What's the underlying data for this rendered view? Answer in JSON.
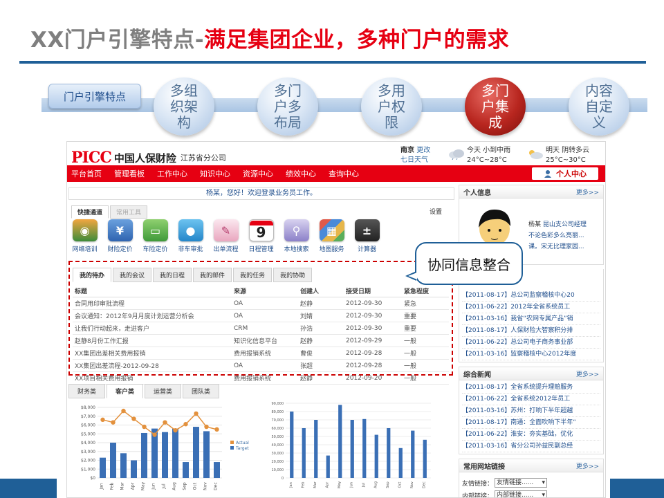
{
  "slide": {
    "title_gray": "XX门户引擎特点-",
    "title_red": "满足集团企业，多种门户的需求",
    "label": "门户引擎特点",
    "circles": [
      "多组织架构",
      "多门户多布局",
      "多用户权限",
      "多门户集成",
      "内容自定义"
    ],
    "active_index": 3,
    "callout": "协同信息整合",
    "colors": {
      "accent_blue": "#1f5f97",
      "brand_red": "#e60012"
    }
  },
  "portal": {
    "logo_mark": "PICC",
    "logo_name": "中国人保财险",
    "logo_branch": "江苏省分公司",
    "weather": {
      "city": "南京",
      "change": "更改",
      "week": "七日天气",
      "today_label": "今天 小到中雨",
      "today_temp": "24°C~28°C",
      "tomorrow_label": "明天 阴转多云",
      "tomorrow_temp": "25°C~30°C"
    },
    "nav": [
      "平台首页",
      "管理看板",
      "工作中心",
      "知识中心",
      "资源中心",
      "绩效中心",
      "查询中心"
    ],
    "personal_center": "个人中心",
    "welcome": "杨某，您好！欢迎登录业务员工作。",
    "quick_tabs": [
      "快捷通道",
      "常用工具"
    ],
    "settings": "设置",
    "apps": [
      {
        "label": "网络培训",
        "icon": "globe-icon"
      },
      {
        "label": "财险定价",
        "icon": "yen-icon"
      },
      {
        "label": "车险定价",
        "icon": "car-icon"
      },
      {
        "label": "非车审批",
        "icon": "chat-icon"
      },
      {
        "label": "出单流程",
        "icon": "pen-icon"
      },
      {
        "label": "日程管理",
        "icon": "calendar-icon",
        "day": "9"
      },
      {
        "label": "本地搜索",
        "icon": "magnifier-icon"
      },
      {
        "label": "地图服务",
        "icon": "map-icon"
      },
      {
        "label": "计算器",
        "icon": "calculator-icon"
      }
    ],
    "todo_tabs": [
      "我的待办",
      "我的会议",
      "我的日程",
      "我的邮件",
      "我的任务",
      "我的协助"
    ],
    "todo_headers": [
      "标题",
      "来源",
      "创建人",
      "接受日期",
      "紧急程度"
    ],
    "todo_rows": [
      [
        "合同用印审批流程",
        "OA",
        "赵静",
        "2012-09-30",
        "紧急"
      ],
      [
        "会议通知：2012年9月月度计划运营分析会",
        "OA",
        "刘婧",
        "2012-09-30",
        "重要"
      ],
      [
        "让我们行动起来，走进客户",
        "CRM",
        "孙浩",
        "2012-09-30",
        "重要"
      ],
      [
        "赵静8月份工作汇报",
        "知识化信息平台",
        "赵静",
        "2012-09-29",
        "一般"
      ],
      [
        "XX集团出差相关费用报销",
        "费用报销系统",
        "曹俊",
        "2012-09-28",
        "一般"
      ],
      [
        "XX集团出差流程-2012-09-28",
        "OA",
        "张超",
        "2012-09-28",
        "一般"
      ],
      [
        "XX项目相关费用报销",
        "费用报销系统",
        "赵静",
        "2012-09-20",
        "一般"
      ]
    ],
    "chart_tabs": [
      "财务类",
      "客户类",
      "运营类",
      "团队类"
    ],
    "right": {
      "personal_title": "个人信息",
      "more": "更多>>",
      "person_name": "杨某",
      "person_role": "昆山支公司经理",
      "person_line2": "不论色彩多么亮丽...",
      "person_line3": "课。宋无比理家园...",
      "news1": [
        "【2011-08-17】总公司监察稽核中心20",
        "【2011-06-22】2012年全省系统员工",
        "【2011-03-16】我省“农网专属产品”销",
        "【2011-08-17】人保财险大智察积分排",
        "【2011-06-22】总公司电子商务事业部",
        "【2011-03-16】监察稽核中心2012年度"
      ],
      "news2_title": "综合新闻",
      "news2": [
        "【2011-08-17】全省系统提升理赔服务",
        "【2011-06-22】全省系统2012年员工",
        "【2011-03-16】苏州：打响下半年超越",
        "【2011-08-17】南通：全面吹响下半年“",
        "【2011-06-22】淮安：夯实基础，优化",
        "【2011-03-16】省分公司孙益民副总经"
      ],
      "links_title": "常用网站链接",
      "friend_label": "友情链接：",
      "friend_value": "友情链接......",
      "internal_label": "内部链接：",
      "internal_value": "内部链接......"
    }
  },
  "chart_data": [
    {
      "type": "bar",
      "categories": [
        "Jan",
        "Feb",
        "Mar",
        "Apr",
        "May",
        "Jun",
        "Jul",
        "Aug",
        "Sep",
        "Oct",
        "Nov",
        "Dec"
      ],
      "series": [
        {
          "name": "Target",
          "type": "bar",
          "values": [
            2300,
            4000,
            2800,
            2000,
            5100,
            5600,
            5200,
            5600,
            1800,
            5800,
            5300,
            1800
          ]
        },
        {
          "name": "Actual",
          "type": "line",
          "values": [
            6600,
            6300,
            7600,
            6700,
            5800,
            4900,
            6300,
            5400,
            6100,
            7300,
            5800,
            5500
          ]
        }
      ],
      "ylim": [
        0,
        8000
      ],
      "yticks": [
        "$0",
        "$1,000",
        "$2,000",
        "$3,000",
        "$4,000",
        "$5,000",
        "$6,000",
        "$7,000",
        "$8,000"
      ],
      "legend": "right",
      "colors": {
        "Target": "#3a6fb5",
        "Actual": "#e3913d"
      }
    },
    {
      "type": "bar",
      "categories": [
        "Jan",
        "Feb",
        "Mar",
        "Apr",
        "May",
        "Jun",
        "Jul",
        "Aug",
        "Sep",
        "Oct",
        "Nov",
        "Dec"
      ],
      "series": [
        {
          "values": [
            80000,
            60000,
            70000,
            27000,
            88000,
            70000,
            71000,
            52000,
            60000,
            36000,
            57000,
            46000
          ]
        }
      ],
      "ylim": [
        0,
        90000
      ],
      "yticks": [
        "0",
        "10,000",
        "20,000",
        "30,000",
        "40,000",
        "50,000",
        "60,000",
        "70,000",
        "80,000",
        "90,000"
      ],
      "colors": {
        "bar": "#3a6fb5"
      }
    }
  ]
}
